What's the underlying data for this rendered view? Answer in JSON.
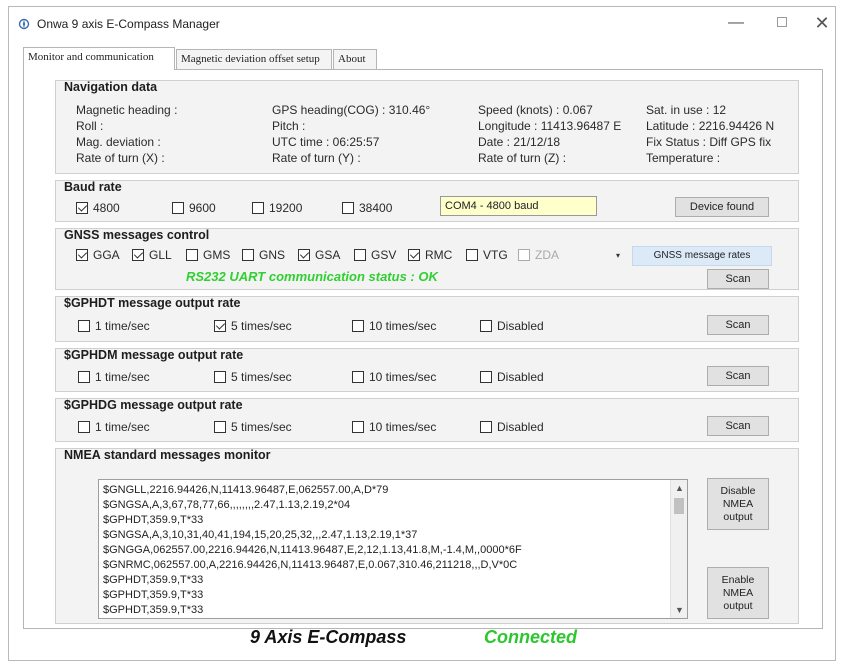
{
  "window": {
    "title": "Onwa 9 axis E-Compass Manager",
    "minimize_glyph": "—",
    "close_glyph": "✕"
  },
  "tabs": [
    {
      "label": "Monitor and communication",
      "active": true
    },
    {
      "label": "Magnetic deviation offset setup",
      "active": false
    },
    {
      "label": "About",
      "active": false
    }
  ],
  "navigation": {
    "title": "Navigation data",
    "cells": [
      [
        "Magnetic heading :",
        "GPS heading(COG) : 310.46°",
        "Speed (knots) : 0.067",
        "Sat. in use : 12"
      ],
      [
        "Roll :",
        "Pitch :",
        "Longitude : 11413.96487 E",
        "Latitude : 2216.94426 N"
      ],
      [
        "Mag. deviation :",
        "UTC time : 06:25:57",
        "Date : 21/12/18",
        "Fix Status : Diff GPS fix"
      ],
      [
        "Rate of turn (X) :",
        "Rate of turn (Y) :",
        "Rate of turn (Z) :",
        "Temperature :"
      ]
    ]
  },
  "baud": {
    "title": "Baud rate",
    "options": [
      {
        "label": "4800",
        "checked": true
      },
      {
        "label": "9600",
        "checked": false
      },
      {
        "label": "19200",
        "checked": false
      },
      {
        "label": "38400",
        "checked": false
      }
    ],
    "port_status": "COM4 - 4800 baud",
    "device_button": "Device found"
  },
  "gnss": {
    "title": "GNSS messages control",
    "messages": [
      {
        "label": "GGA",
        "checked": true,
        "disabled": false
      },
      {
        "label": "GLL",
        "checked": true,
        "disabled": false
      },
      {
        "label": "GMS",
        "checked": false,
        "disabled": false
      },
      {
        "label": "GNS",
        "checked": false,
        "disabled": false
      },
      {
        "label": "GSA",
        "checked": true,
        "disabled": false
      },
      {
        "label": "GSV",
        "checked": false,
        "disabled": false
      },
      {
        "label": "RMC",
        "checked": true,
        "disabled": false
      },
      {
        "label": "VTG",
        "checked": false,
        "disabled": false
      },
      {
        "label": "ZDA",
        "checked": false,
        "disabled": true
      }
    ],
    "dropdown_glyph": "▾",
    "rates_button": "GNSS message rates",
    "uart_status": "RS232 UART communication status : OK",
    "scan_button": "Scan"
  },
  "rate_groups": [
    {
      "title": "$GPHDT message output rate",
      "scan": "Scan",
      "options": [
        {
          "label": "1 time/sec",
          "checked": false
        },
        {
          "label": "5 times/sec",
          "checked": true
        },
        {
          "label": "10 times/sec",
          "checked": false
        },
        {
          "label": "Disabled",
          "checked": false
        }
      ]
    },
    {
      "title": "$GPHDM message output rate",
      "scan": "Scan",
      "options": [
        {
          "label": "1 time/sec",
          "checked": false
        },
        {
          "label": "5 times/sec",
          "checked": false
        },
        {
          "label": "10 times/sec",
          "checked": false
        },
        {
          "label": "Disabled",
          "checked": false
        }
      ]
    },
    {
      "title": "$GPHDG message output rate",
      "scan": "Scan",
      "options": [
        {
          "label": "1 time/sec",
          "checked": false
        },
        {
          "label": "5 times/sec",
          "checked": false
        },
        {
          "label": "10 times/sec",
          "checked": false
        },
        {
          "label": "Disabled",
          "checked": false
        }
      ]
    }
  ],
  "nmea": {
    "title": "NMEA standard messages monitor",
    "lines": [
      "$GNGLL,2216.94426,N,11413.96487,E,062557.00,A,D*79",
      "$GNGSA,A,3,67,78,77,66,,,,,,,,2.47,1.13,2.19,2*04",
      "$GPHDT,359.9,T*33",
      "$GNGSA,A,3,10,31,40,41,194,15,20,25,32,,,2.47,1.13,2.19,1*37",
      "$GNGGA,062557.00,2216.94426,N,11413.96487,E,2,12,1.13,41.8,M,-1.4,M,,0000*6F",
      "$GNRMC,062557.00,A,2216.94426,N,11413.96487,E,0.067,310.46,211218,,,D,V*0C",
      "$GPHDT,359.9,T*33",
      "$GPHDT,359.9,T*33",
      "$GPHDT,359.9,T*33"
    ],
    "scroll_up": "▲",
    "scroll_down": "▼",
    "disable_button": [
      "Disable",
      "NMEA",
      "output"
    ],
    "enable_button": [
      "Enable",
      "NMEA",
      "output"
    ]
  },
  "footer": {
    "device_name": "9 Axis E-Compass",
    "connection_status": "Connected"
  }
}
